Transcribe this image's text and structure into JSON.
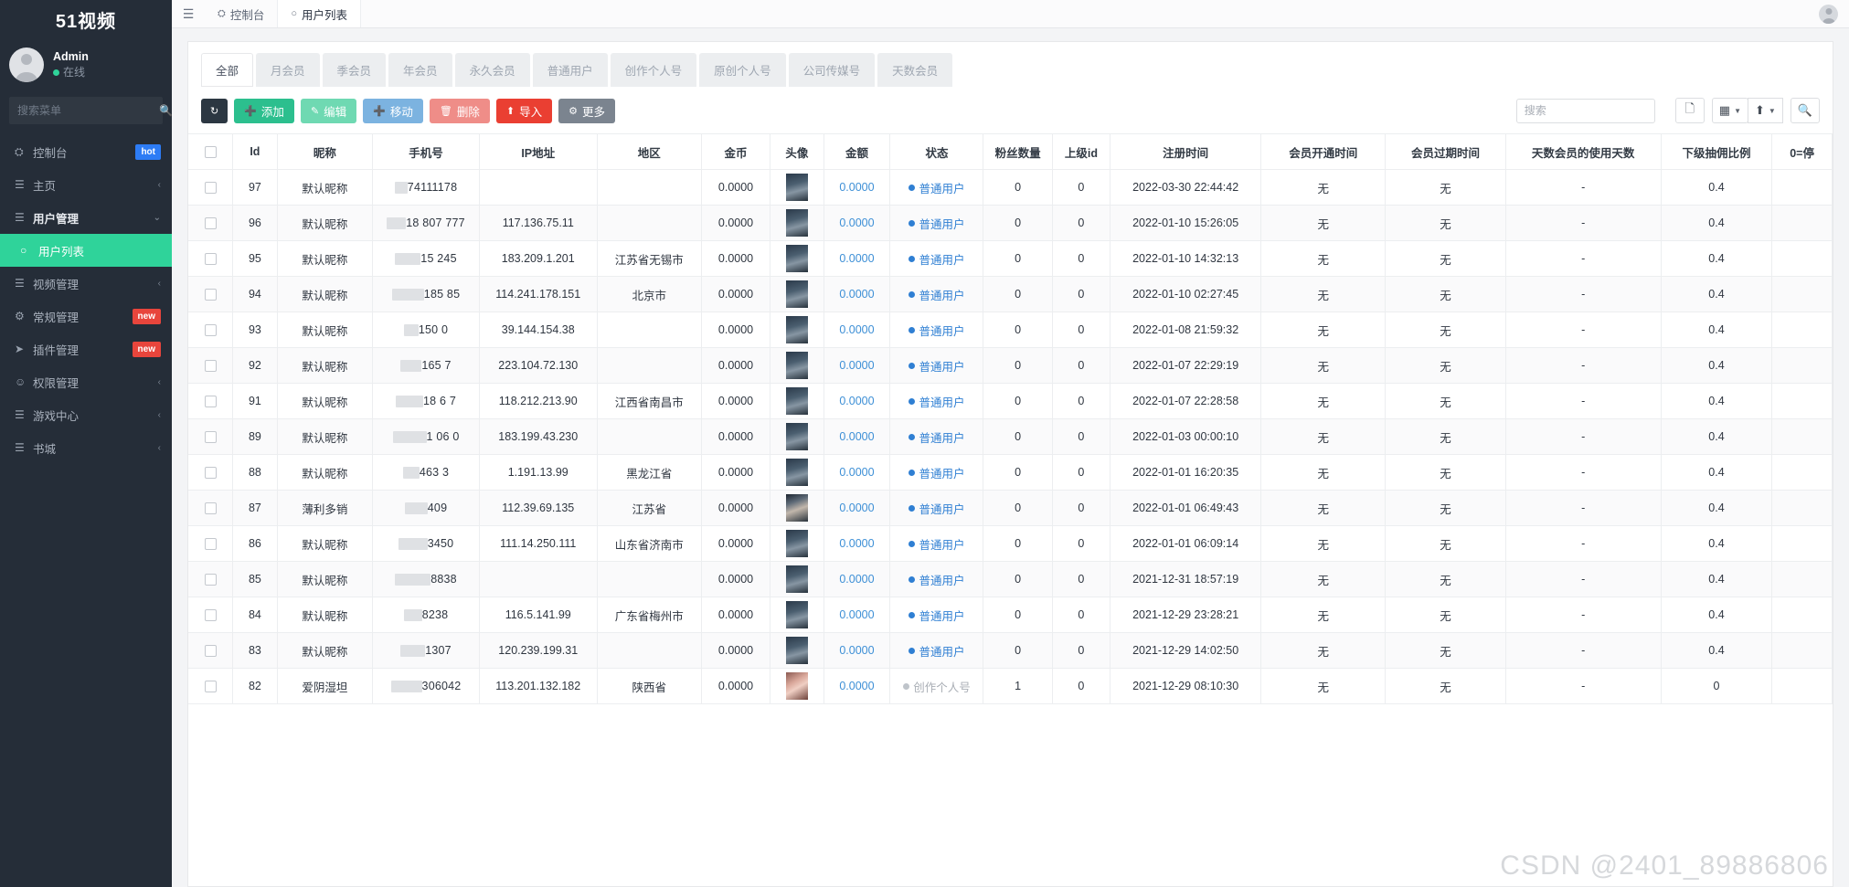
{
  "sidebar": {
    "brand": "51视频",
    "user": {
      "name": "Admin",
      "status": "在线"
    },
    "search_placeholder": "搜索菜单",
    "items": [
      {
        "label": "控制台",
        "icon": "dashboard-icon",
        "badge": "hot",
        "badge_type": "hot",
        "caret": "",
        "state": "normal"
      },
      {
        "label": "主页",
        "icon": "list-icon",
        "badge": "",
        "badge_type": "",
        "caret": "‹",
        "state": "normal"
      },
      {
        "label": "用户管理",
        "icon": "list-icon",
        "badge": "",
        "badge_type": "",
        "caret": "⌄",
        "state": "open"
      },
      {
        "label": "用户列表",
        "icon": "circle-icon",
        "badge": "",
        "badge_type": "",
        "caret": "",
        "state": "active"
      },
      {
        "label": "视频管理",
        "icon": "list-icon",
        "badge": "",
        "badge_type": "",
        "caret": "‹",
        "state": "normal"
      },
      {
        "label": "常规管理",
        "icon": "gears-icon",
        "badge": "new",
        "badge_type": "new",
        "caret": "",
        "state": "normal"
      },
      {
        "label": "插件管理",
        "icon": "rocket-icon",
        "badge": "new",
        "badge_type": "new",
        "caret": "",
        "state": "normal"
      },
      {
        "label": "权限管理",
        "icon": "users-icon",
        "badge": "",
        "badge_type": "",
        "caret": "‹",
        "state": "normal"
      },
      {
        "label": "游戏中心",
        "icon": "list-icon",
        "badge": "",
        "badge_type": "",
        "caret": "‹",
        "state": "normal"
      },
      {
        "label": "书城",
        "icon": "list-icon",
        "badge": "",
        "badge_type": "",
        "caret": "‹",
        "state": "normal"
      }
    ]
  },
  "topbar": {
    "hamburger": "☰",
    "tabs": [
      {
        "label": "控制台",
        "icon": "dashboard-icon",
        "active": false
      },
      {
        "label": "用户列表",
        "icon": "circle-icon",
        "active": true
      }
    ]
  },
  "filter_tabs": [
    {
      "label": "全部",
      "active": true
    },
    {
      "label": "月会员",
      "active": false
    },
    {
      "label": "季会员",
      "active": false
    },
    {
      "label": "年会员",
      "active": false
    },
    {
      "label": "永久会员",
      "active": false
    },
    {
      "label": "普通用户",
      "active": false
    },
    {
      "label": "创作个人号",
      "active": false
    },
    {
      "label": "原创个人号",
      "active": false
    },
    {
      "label": "公司传媒号",
      "active": false
    },
    {
      "label": "天数会员",
      "active": false
    }
  ],
  "toolbar": {
    "refresh_icon": "↻",
    "add_label": "添加",
    "edit_label": "编辑",
    "move_label": "移动",
    "delete_label": "删除",
    "import_label": "导入",
    "more_label": "更多",
    "search_placeholder": "搜索",
    "icon_buttons": [
      "card-view-icon",
      "grid-columns-icon",
      "export-icon",
      "search-icon"
    ]
  },
  "table": {
    "headers": [
      "Id",
      "昵称",
      "手机号",
      "IP地址",
      "地区",
      "金币",
      "头像",
      "金额",
      "状态",
      "粉丝数量",
      "上级id",
      "注册时间",
      "会员开通时间",
      "会员过期时间",
      "天数会员的使用天数",
      "下级抽佣比例",
      "0=停"
    ],
    "rows": [
      {
        "id": "97",
        "nick": "默认昵称",
        "phone": "74111178",
        "ip": "",
        "region": "",
        "coin": "0.0000",
        "thumb": "t1",
        "amount": "0.0000",
        "status": "普通用户",
        "status_type": "blue",
        "fans": "0",
        "parent_id": "0",
        "reg_time": "2022-03-30 22:44:42",
        "vip_start": "无",
        "vip_end": "无",
        "days_used": "-",
        "commission": "0.4",
        "stop": ""
      },
      {
        "id": "96",
        "nick": "默认昵称",
        "phone": "18  807 777",
        "ip": "117.136.75.11",
        "region": "",
        "coin": "0.0000",
        "thumb": "t1",
        "amount": "0.0000",
        "status": "普通用户",
        "status_type": "blue",
        "fans": "0",
        "parent_id": "0",
        "reg_time": "2022-01-10 15:26:05",
        "vip_start": "无",
        "vip_end": "无",
        "days_used": "-",
        "commission": "0.4",
        "stop": ""
      },
      {
        "id": "95",
        "nick": "默认昵称",
        "phone": "15    245",
        "ip": "183.209.1.201",
        "region": "江苏省无锡市",
        "coin": "0.0000",
        "thumb": "t1",
        "amount": "0.0000",
        "status": "普通用户",
        "status_type": "blue",
        "fans": "0",
        "parent_id": "0",
        "reg_time": "2022-01-10 14:32:13",
        "vip_start": "无",
        "vip_end": "无",
        "days_used": "-",
        "commission": "0.4",
        "stop": ""
      },
      {
        "id": "94",
        "nick": "默认昵称",
        "phone": "185    85",
        "ip": "114.241.178.151",
        "region": "北京市",
        "coin": "0.0000",
        "thumb": "t1",
        "amount": "0.0000",
        "status": "普通用户",
        "status_type": "blue",
        "fans": "0",
        "parent_id": "0",
        "reg_time": "2022-01-10 02:27:45",
        "vip_start": "无",
        "vip_end": "无",
        "days_used": "-",
        "commission": "0.4",
        "stop": ""
      },
      {
        "id": "93",
        "nick": "默认昵称",
        "phone": "150    0",
        "ip": "39.144.154.38",
        "region": "",
        "coin": "0.0000",
        "thumb": "t1",
        "amount": "0.0000",
        "status": "普通用户",
        "status_type": "blue",
        "fans": "0",
        "parent_id": "0",
        "reg_time": "2022-01-08 21:59:32",
        "vip_start": "无",
        "vip_end": "无",
        "days_used": "-",
        "commission": "0.4",
        "stop": ""
      },
      {
        "id": "92",
        "nick": "默认昵称",
        "phone": "165    7",
        "ip": "223.104.72.130",
        "region": "",
        "coin": "0.0000",
        "thumb": "t1",
        "amount": "0.0000",
        "status": "普通用户",
        "status_type": "blue",
        "fans": "0",
        "parent_id": "0",
        "reg_time": "2022-01-07 22:29:19",
        "vip_start": "无",
        "vip_end": "无",
        "days_used": "-",
        "commission": "0.4",
        "stop": ""
      },
      {
        "id": "91",
        "nick": "默认昵称",
        "phone": "18  6  7",
        "ip": "118.212.213.90",
        "region": "江西省南昌市",
        "coin": "0.0000",
        "thumb": "t1",
        "amount": "0.0000",
        "status": "普通用户",
        "status_type": "blue",
        "fans": "0",
        "parent_id": "0",
        "reg_time": "2022-01-07 22:28:58",
        "vip_start": "无",
        "vip_end": "无",
        "days_used": "-",
        "commission": "0.4",
        "stop": ""
      },
      {
        "id": "89",
        "nick": "默认昵称",
        "phone": "1  06  0",
        "ip": "183.199.43.230",
        "region": "",
        "coin": "0.0000",
        "thumb": "t1",
        "amount": "0.0000",
        "status": "普通用户",
        "status_type": "blue",
        "fans": "0",
        "parent_id": "0",
        "reg_time": "2022-01-03 00:00:10",
        "vip_start": "无",
        "vip_end": "无",
        "days_used": "-",
        "commission": "0.4",
        "stop": ""
      },
      {
        "id": "88",
        "nick": "默认昵称",
        "phone": "463  3",
        "ip": "1.191.13.99",
        "region": "黑龙江省",
        "coin": "0.0000",
        "thumb": "t1",
        "amount": "0.0000",
        "status": "普通用户",
        "status_type": "blue",
        "fans": "0",
        "parent_id": "0",
        "reg_time": "2022-01-01 16:20:35",
        "vip_start": "无",
        "vip_end": "无",
        "days_used": "-",
        "commission": "0.4",
        "stop": ""
      },
      {
        "id": "87",
        "nick": "薄利多销",
        "phone": "409",
        "ip": "112.39.69.135",
        "region": "江苏省",
        "coin": "0.0000",
        "thumb": "t2",
        "amount": "0.0000",
        "status": "普通用户",
        "status_type": "blue",
        "fans": "0",
        "parent_id": "0",
        "reg_time": "2022-01-01 06:49:43",
        "vip_start": "无",
        "vip_end": "无",
        "days_used": "-",
        "commission": "0.4",
        "stop": ""
      },
      {
        "id": "86",
        "nick": "默认昵称",
        "phone": "3450",
        "ip": "111.14.250.111",
        "region": "山东省济南市",
        "coin": "0.0000",
        "thumb": "t1",
        "amount": "0.0000",
        "status": "普通用户",
        "status_type": "blue",
        "fans": "0",
        "parent_id": "0",
        "reg_time": "2022-01-01 06:09:14",
        "vip_start": "无",
        "vip_end": "无",
        "days_used": "-",
        "commission": "0.4",
        "stop": ""
      },
      {
        "id": "85",
        "nick": "默认昵称",
        "phone": "8838",
        "ip": "",
        "region": "",
        "coin": "0.0000",
        "thumb": "t1",
        "amount": "0.0000",
        "status": "普通用户",
        "status_type": "blue",
        "fans": "0",
        "parent_id": "0",
        "reg_time": "2021-12-31 18:57:19",
        "vip_start": "无",
        "vip_end": "无",
        "days_used": "-",
        "commission": "0.4",
        "stop": ""
      },
      {
        "id": "84",
        "nick": "默认昵称",
        "phone": "8238",
        "ip": "116.5.141.99",
        "region": "广东省梅州市",
        "coin": "0.0000",
        "thumb": "t1",
        "amount": "0.0000",
        "status": "普通用户",
        "status_type": "blue",
        "fans": "0",
        "parent_id": "0",
        "reg_time": "2021-12-29 23:28:21",
        "vip_start": "无",
        "vip_end": "无",
        "days_used": "-",
        "commission": "0.4",
        "stop": ""
      },
      {
        "id": "83",
        "nick": "默认昵称",
        "phone": "1307",
        "ip": "120.239.199.31",
        "region": "",
        "coin": "0.0000",
        "thumb": "t1",
        "amount": "0.0000",
        "status": "普通用户",
        "status_type": "blue",
        "fans": "0",
        "parent_id": "0",
        "reg_time": "2021-12-29 14:02:50",
        "vip_start": "无",
        "vip_end": "无",
        "days_used": "-",
        "commission": "0.4",
        "stop": ""
      },
      {
        "id": "82",
        "nick": "爱阴湿坦",
        "phone": "306042",
        "ip": "113.201.132.182",
        "region": "陕西省",
        "coin": "0.0000",
        "thumb": "t3",
        "amount": "0.0000",
        "status": "创作个人号",
        "status_type": "gray",
        "fans": "1",
        "parent_id": "0",
        "reg_time": "2021-12-29 08:10:30",
        "vip_start": "无",
        "vip_end": "无",
        "days_used": "-",
        "commission": "0",
        "stop": ""
      }
    ]
  },
  "watermark": "CSDN @2401_89886806",
  "colors": {
    "accent": "#2fd39a",
    "sidebar_bg": "#252d38",
    "status_blue": "#2f7fd3",
    "import_red": "#ea3f32"
  }
}
